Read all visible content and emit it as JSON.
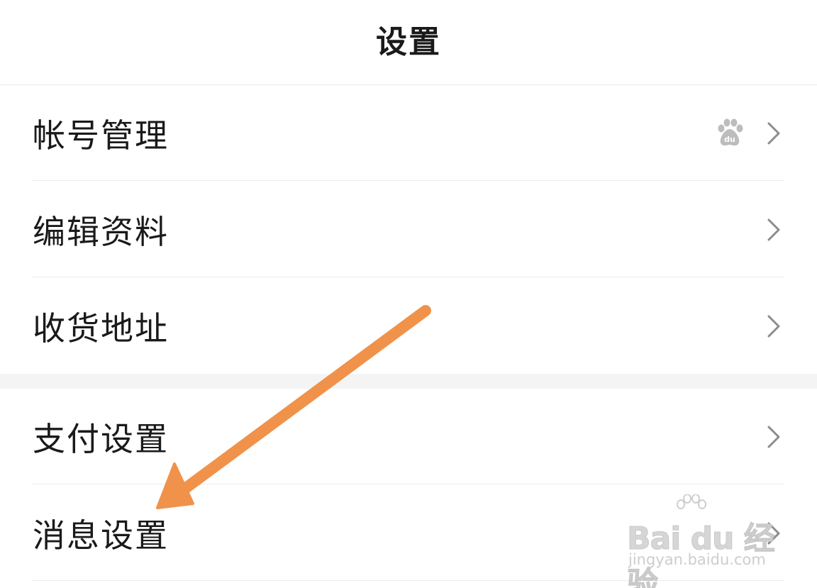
{
  "header": {
    "title": "设置"
  },
  "groups": [
    {
      "items": [
        {
          "label": "帐号管理",
          "has_baidu_icon": true
        },
        {
          "label": "编辑资料"
        },
        {
          "label": "收货地址"
        }
      ]
    },
    {
      "items": [
        {
          "label": "支付设置"
        },
        {
          "label": "消息设置"
        }
      ]
    }
  ],
  "icons": {
    "chevron": "chevron-right-icon",
    "account_badge": "baidu-paw-icon",
    "annotation": "orange-arrow-annotation"
  },
  "annotation": {
    "color": "#F0924A",
    "points_to": "消息设置"
  },
  "watermark": {
    "brand": "Bai du 经验",
    "url": "jingyan.baidu.com"
  },
  "colors": {
    "text": "#1a1a1a",
    "chevron": "#8c8c8c",
    "divider": "#ececec",
    "group_gap": "#f4f4f4",
    "arrow": "#F0924A"
  }
}
